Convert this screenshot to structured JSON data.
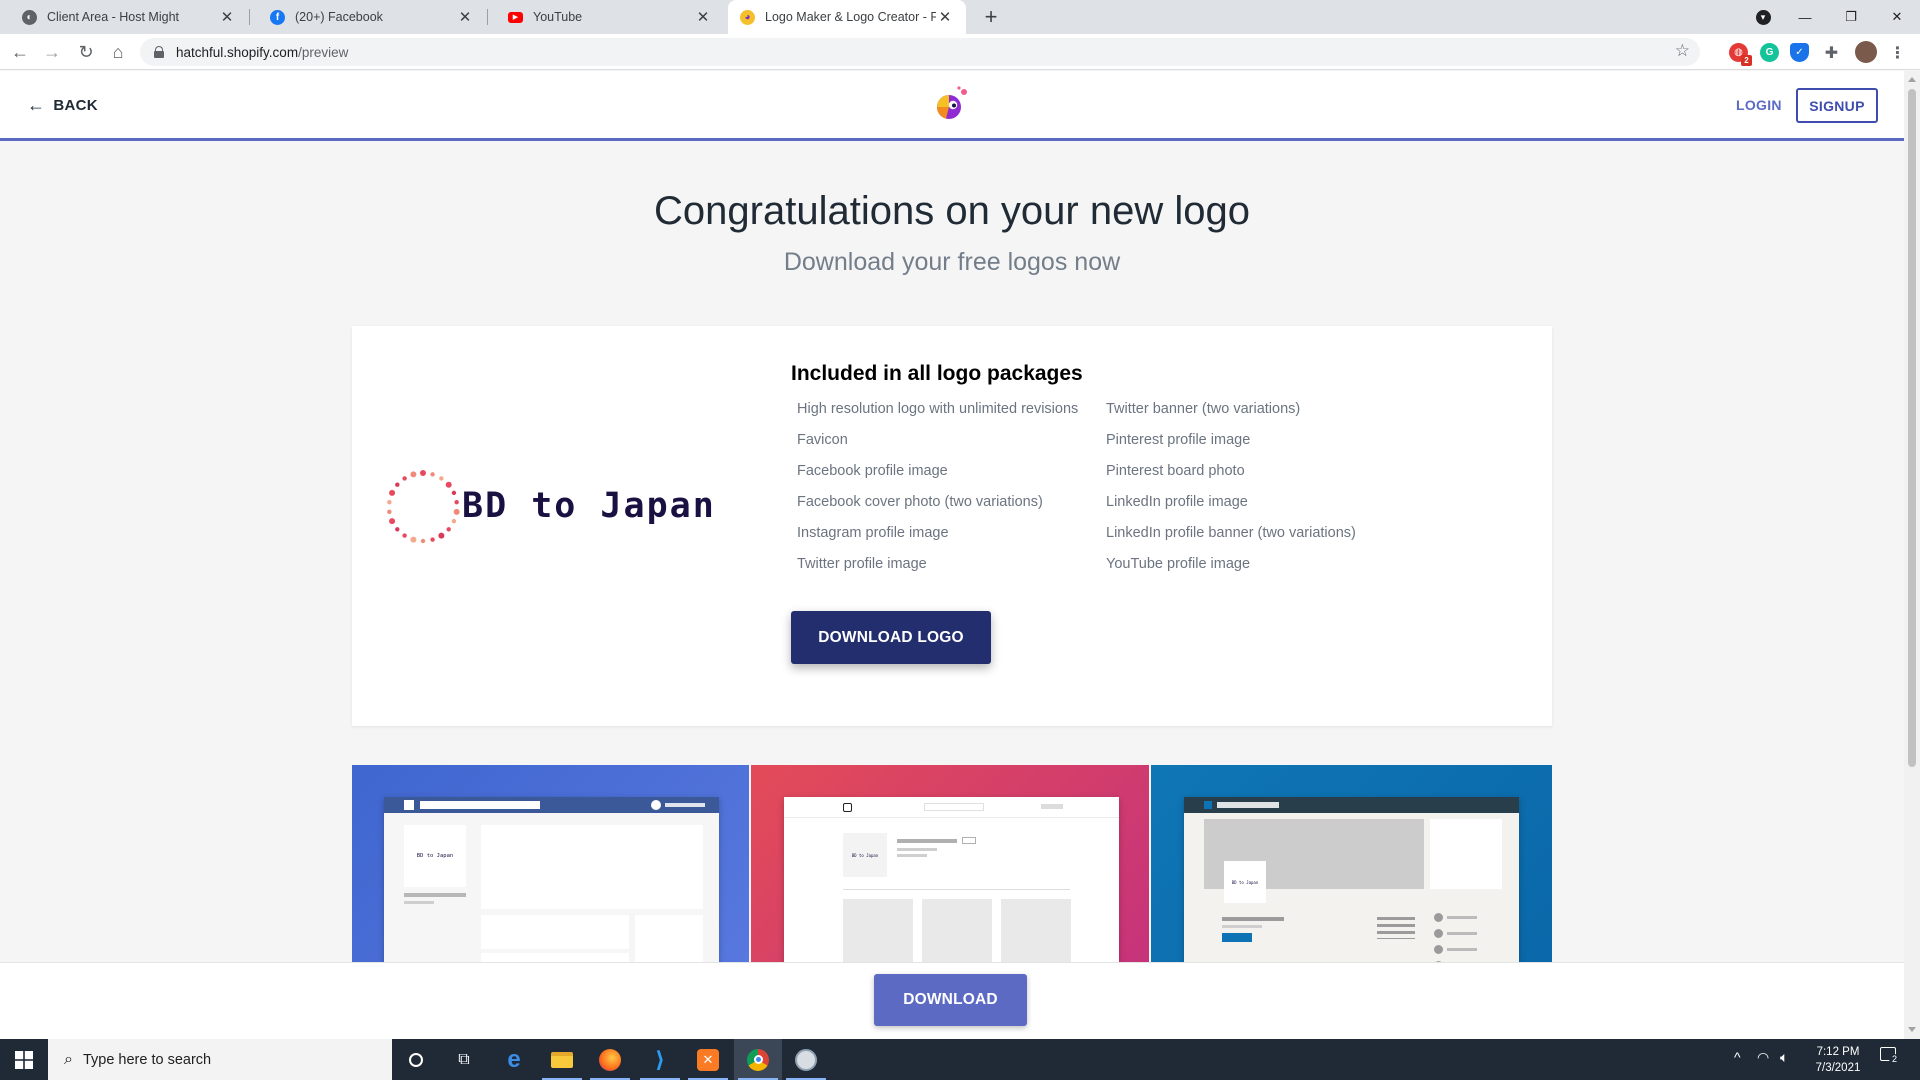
{
  "browser": {
    "tabs": [
      {
        "title": "Client Area - Host Might",
        "active": false
      },
      {
        "title": "(20+) Facebook",
        "active": false
      },
      {
        "title": "YouTube",
        "active": false
      },
      {
        "title": "Logo Maker & Logo Creator - Fre",
        "active": true
      }
    ],
    "address": {
      "host": "hatchful.shopify.com",
      "path": "/preview"
    },
    "extension_badge": "2"
  },
  "header": {
    "back_label": "BACK",
    "login_label": "LOGIN",
    "signup_label": "SIGNUP"
  },
  "hero": {
    "title": "Congratulations on your new logo",
    "subtitle": "Download your free logos now"
  },
  "logo": {
    "name": "BD to Japan"
  },
  "packages": {
    "title": "Included in all logo packages",
    "left": [
      "High resolution logo with unlimited revisions",
      "Favicon",
      "Facebook profile image",
      "Facebook cover photo (two variations)",
      "Instagram profile image",
      "Twitter profile image"
    ],
    "right": [
      "Twitter banner (two variations)",
      "Pinterest profile image",
      "Pinterest board photo",
      "LinkedIn profile image",
      "LinkedIn profile banner (two variations)",
      "YouTube profile image"
    ],
    "download_logo_label": "DOWNLOAD LOGO"
  },
  "mockups": {
    "facebook_logo_text": "BD to Japan",
    "instagram_logo_text": "BD to Japan",
    "linkedin_logo_text": "BD to Japan",
    "colors": {
      "facebook": "#4a6cd4",
      "instagram": "#d63a6a",
      "linkedin": "#0e73b4"
    }
  },
  "bottom": {
    "download_label": "DOWNLOAD"
  },
  "taskbar": {
    "search_placeholder": "Type here to search",
    "time": "7:12 PM",
    "date": "7/3/2021",
    "notifications": "2"
  },
  "colors": {
    "accent": "#5c6ac4",
    "primary_dark": "#232e6e"
  }
}
